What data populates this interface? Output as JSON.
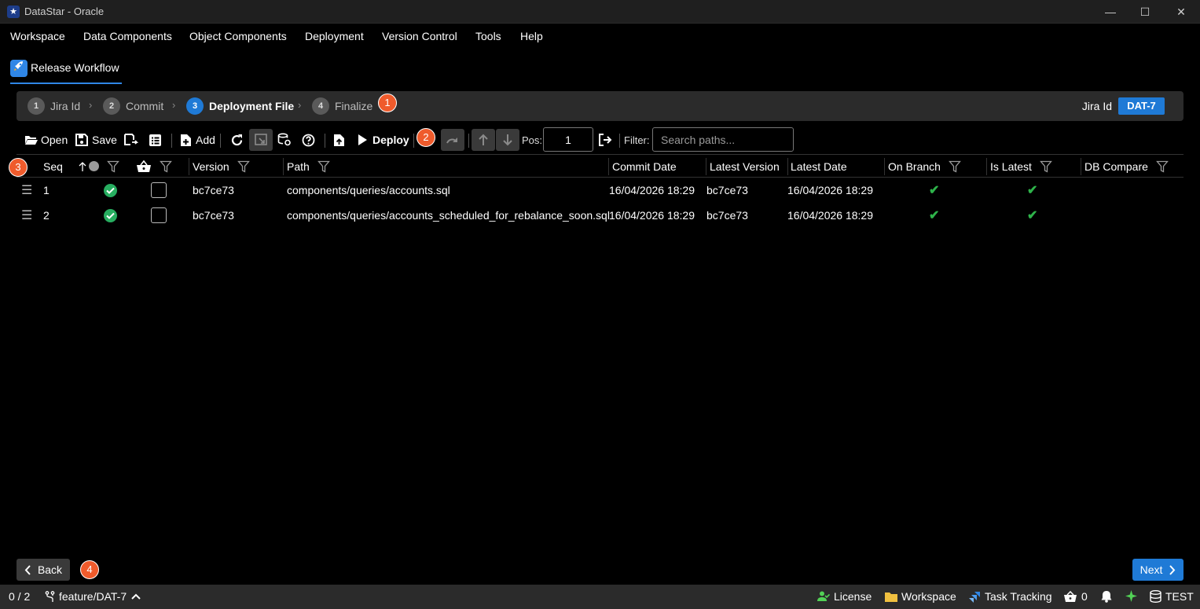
{
  "window": {
    "title": "DataStar - Oracle",
    "minimize": "—",
    "maximize": "☐",
    "close": "✕"
  },
  "menu": [
    "Workspace",
    "Data Components",
    "Object Components",
    "Deployment",
    "Version Control",
    "Tools",
    "Help"
  ],
  "tab": {
    "label": "Release Workflow",
    "icon": "rocket-icon"
  },
  "stepper": {
    "steps": [
      {
        "num": "1",
        "label": "Jira Id"
      },
      {
        "num": "2",
        "label": "Commit"
      },
      {
        "num": "3",
        "label": "Deployment File"
      },
      {
        "num": "4",
        "label": "Finalize"
      }
    ],
    "active_step": 3,
    "jira_label": "Jira Id",
    "jira_value": "DAT-7"
  },
  "callouts": [
    "1",
    "2",
    "3",
    "4"
  ],
  "toolbar": {
    "open": "Open",
    "save": "Save",
    "add": "Add",
    "deploy": "Deploy",
    "pos_label": "Pos:",
    "pos_value": "1",
    "filter_label": "Filter:",
    "search_placeholder": "Search paths..."
  },
  "table": {
    "headers": {
      "seq": "Seq",
      "version": "Version",
      "path": "Path",
      "commit_date": "Commit Date",
      "latest_version": "Latest Version",
      "latest_date": "Latest Date",
      "on_branch": "On Branch",
      "is_latest": "Is Latest",
      "db_compare": "DB Compare"
    },
    "rows": [
      {
        "seq": "1",
        "version": "bc7ce73",
        "path": "components/queries/accounts.sql",
        "commit_date": "16/04/2026 18:29",
        "latest_version": "bc7ce73",
        "latest_date": "16/04/2026 18:29",
        "on_branch": true,
        "is_latest": true,
        "status_ok": true,
        "in_basket": false
      },
      {
        "seq": "2",
        "version": "bc7ce73",
        "path": "components/queries/accounts_scheduled_for_rebalance_soon.sql",
        "commit_date": "16/04/2026 18:29",
        "latest_version": "bc7ce73",
        "latest_date": "16/04/2026 18:29",
        "on_branch": true,
        "is_latest": true,
        "status_ok": true,
        "in_basket": false
      }
    ]
  },
  "footer": {
    "back": "Back",
    "next": "Next"
  },
  "status": {
    "count": "0 / 2",
    "branch": "feature/DAT-7",
    "license": "License",
    "workspace": "Workspace",
    "task_tracking": "Task Tracking",
    "basket_count": "0",
    "env": "TEST"
  },
  "colors": {
    "accent": "#1f7ad6",
    "callout": "#ef5b2c",
    "ok": "#27ae60",
    "check": "#2eb34a"
  }
}
